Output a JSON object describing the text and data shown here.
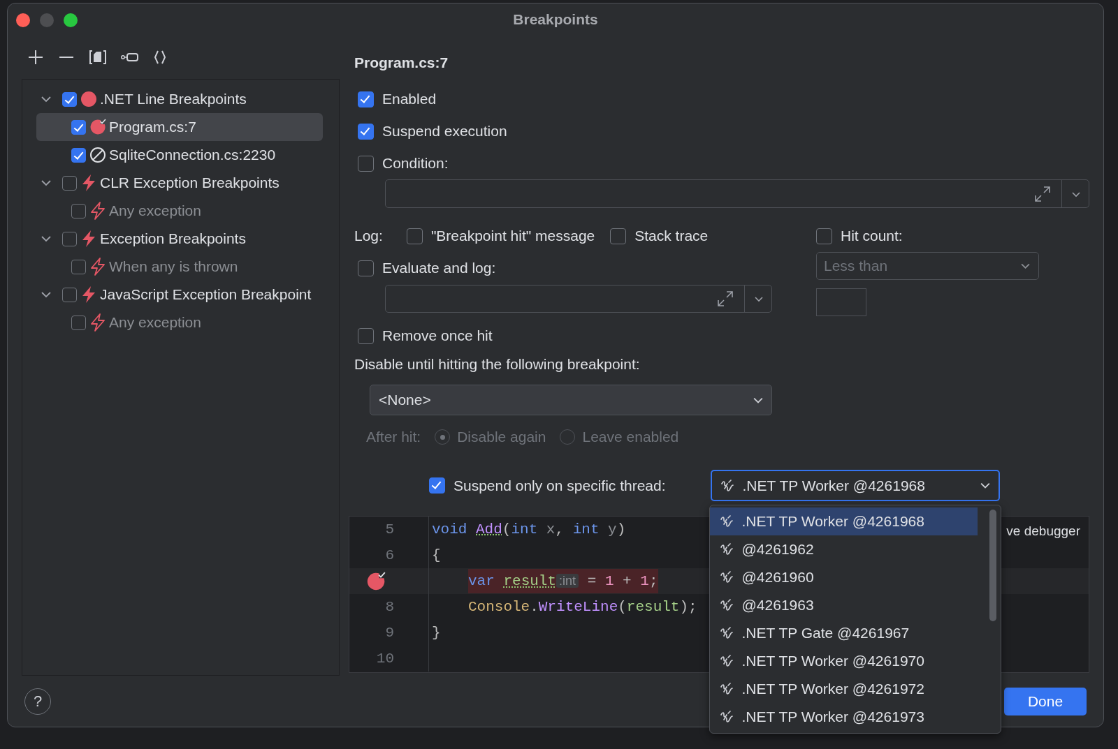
{
  "window": {
    "title": "Breakpoints"
  },
  "tree": [
    {
      "label": ".NET Line Breakpoints",
      "kind": "line",
      "checked": true,
      "expanded": true,
      "selected": false,
      "children": [
        {
          "label": "Program.cs:7",
          "kind": "verified",
          "checked": true,
          "selected": true
        },
        {
          "label": "SqliteConnection.cs:2230",
          "kind": "muted",
          "checked": true,
          "selected": false
        }
      ]
    },
    {
      "label": "CLR Exception Breakpoints",
      "kind": "exception",
      "checked": false,
      "expanded": true,
      "selected": false,
      "children": [
        {
          "label": "Any exception",
          "kind": "exception",
          "checked": false,
          "selected": false
        }
      ]
    },
    {
      "label": "Exception Breakpoints",
      "kind": "exception",
      "checked": false,
      "expanded": true,
      "selected": false,
      "children": [
        {
          "label": "When any is thrown",
          "kind": "exception",
          "checked": false,
          "selected": false
        }
      ]
    },
    {
      "label": "JavaScript Exception Breakpoint",
      "kind": "exception",
      "checked": false,
      "expanded": true,
      "selected": false,
      "children": [
        {
          "label": "Any exception",
          "kind": "exception",
          "checked": false,
          "selected": false
        }
      ]
    }
  ],
  "detail": {
    "title": "Program.cs:7",
    "enabled": {
      "label": "Enabled",
      "checked": true
    },
    "suspend": {
      "label": "Suspend execution",
      "checked": true
    },
    "condition": {
      "label": "Condition:",
      "checked": false
    },
    "log_label": "Log:",
    "hit_message": {
      "label": "\"Breakpoint hit\" message",
      "checked": false
    },
    "stack_trace": {
      "label": "Stack trace",
      "checked": false
    },
    "hit_count": {
      "label": "Hit count:",
      "checked": false
    },
    "hit_count_mode": {
      "value": "Less than",
      "disabled": true
    },
    "evaluate": {
      "label": "Evaluate and log:",
      "checked": false
    },
    "remove_once_hit": {
      "label": "Remove once hit",
      "checked": false
    },
    "disable_until": "Disable until hitting the following breakpoint:",
    "dependency": {
      "value": "<None>"
    },
    "after_hit": {
      "label": "After hit:",
      "disabled": true,
      "options": [
        {
          "label": "Disable again",
          "selected": true
        },
        {
          "label": "Leave enabled",
          "selected": false
        }
      ]
    },
    "thread": {
      "label": "Suspend only on specific thread:",
      "checked": true,
      "value": ".NET TP Worker @4261968",
      "options": [
        {
          "label": ".NET TP Worker @4261968",
          "selected": true
        },
        {
          "label": "@4261962",
          "selected": false
        },
        {
          "label": "@4261960",
          "selected": false
        },
        {
          "label": "@4261963",
          "selected": false
        },
        {
          "label": ".NET TP Gate @4261967",
          "selected": false
        },
        {
          "label": ".NET TP Worker @4261970",
          "selected": false
        },
        {
          "label": ".NET TP Worker @4261972",
          "selected": false
        },
        {
          "label": ".NET TP Worker @4261973",
          "selected": false
        }
      ]
    }
  },
  "code": {
    "behind_text": "ve debugger",
    "lines": [
      {
        "number": "5",
        "breakpoint": false,
        "indented": false,
        "tokens": [
          {
            "kind": "keyword",
            "text": "void "
          },
          {
            "kind": "method",
            "text": "Add"
          },
          {
            "kind": "plain",
            "text": "("
          },
          {
            "kind": "keyword",
            "text": "int "
          },
          {
            "kind": "param",
            "text": "x"
          },
          {
            "kind": "plain",
            "text": ", "
          },
          {
            "kind": "keyword",
            "text": "int "
          },
          {
            "kind": "param",
            "text": "y"
          },
          {
            "kind": "plain",
            "text": ")"
          }
        ]
      },
      {
        "number": "6",
        "breakpoint": false,
        "indented": false,
        "tokens": [
          {
            "kind": "plain",
            "text": "{"
          }
        ]
      },
      {
        "breakpoint": true,
        "indented": true,
        "tokens": [
          {
            "kind": "keyword",
            "text": "var "
          },
          {
            "kind": "local",
            "text": "result"
          },
          {
            "kind": "hint",
            "text": ":int"
          },
          {
            "kind": "plain",
            "text": " = "
          },
          {
            "kind": "number",
            "text": "1"
          },
          {
            "kind": "plain",
            "text": " + "
          },
          {
            "kind": "number",
            "text": "1"
          },
          {
            "kind": "plain",
            "text": ";"
          }
        ]
      },
      {
        "number": "8",
        "breakpoint": false,
        "indented": true,
        "tokens": [
          {
            "kind": "type",
            "text": "Console"
          },
          {
            "kind": "plain",
            "text": "."
          },
          {
            "kind": "call",
            "text": "WriteLine"
          },
          {
            "kind": "plain",
            "text": "("
          },
          {
            "kind": "local_plain",
            "text": "result"
          },
          {
            "kind": "plain",
            "text": ");"
          }
        ]
      },
      {
        "number": "9",
        "breakpoint": false,
        "indented": false,
        "tokens": [
          {
            "kind": "plain",
            "text": "}"
          }
        ]
      },
      {
        "number": "10",
        "breakpoint": false
      }
    ]
  },
  "help": "?",
  "done": "Done"
}
